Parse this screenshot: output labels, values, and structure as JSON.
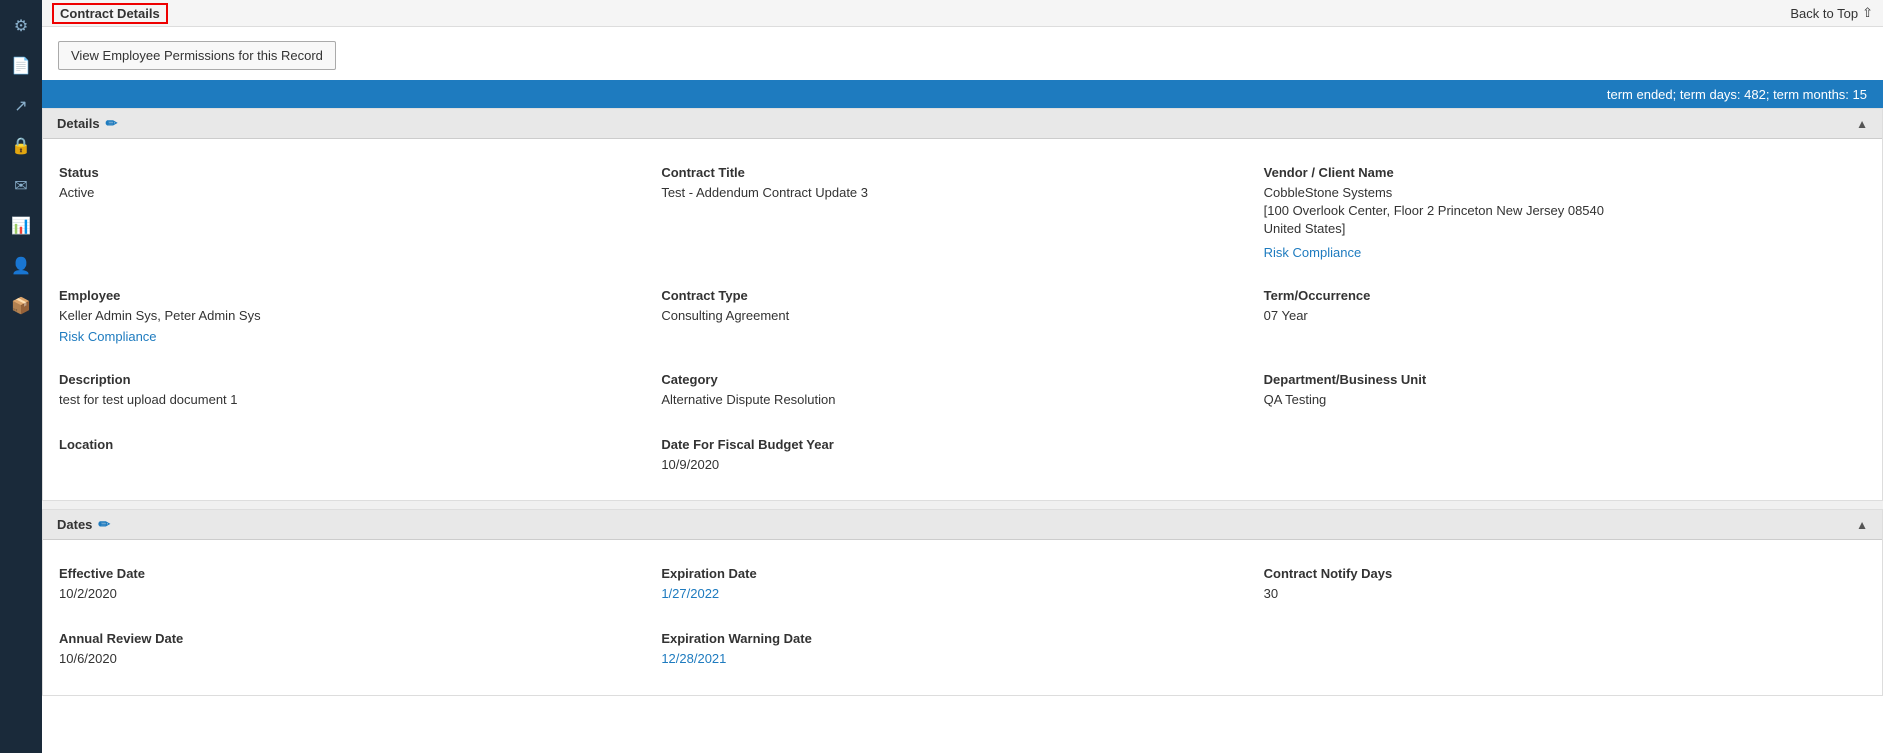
{
  "topbar": {
    "title": "Contract Details",
    "back_to_top": "Back to Top"
  },
  "permissions_button": "View Employee Permissions for this Record",
  "banner": {
    "text": "term ended; term days: 482; term months: 15"
  },
  "details_section": {
    "header": "Details",
    "collapse_icon": "▲",
    "fields": [
      {
        "row": 1,
        "col1_label": "Status",
        "col1_value": "Active",
        "col1_link": null,
        "col2_label": "Contract Title",
        "col2_value": "Test - Addendum Contract Update 3",
        "col2_link": null,
        "col3_label": "Vendor / Client Name",
        "col3_value": "CobbleStone Systems\n[100 Overlook Center, Floor 2 Princeton New Jersey 08540\nUnited States]",
        "col3_link": "Risk Compliance"
      },
      {
        "row": 2,
        "col1_label": "Employee",
        "col1_value": "Keller Admin Sys, Peter Admin Sys",
        "col1_link": "Risk Compliance",
        "col2_label": "Contract Type",
        "col2_value": "Consulting Agreement",
        "col2_link": null,
        "col3_label": "Term/Occurrence",
        "col3_value": "07 Year",
        "col3_link": null
      },
      {
        "row": 3,
        "col1_label": "Description",
        "col1_value": "test for test upload document 1",
        "col1_link": null,
        "col2_label": "Category",
        "col2_value": "Alternative Dispute Resolution",
        "col2_link": null,
        "col3_label": "Department/Business Unit",
        "col3_value": "QA Testing",
        "col3_link": null
      },
      {
        "row": 4,
        "col1_label": "Location",
        "col1_value": "",
        "col1_link": null,
        "col2_label": "Date For Fiscal Budget Year",
        "col2_value": "10/9/2020",
        "col2_link": null,
        "col3_label": "",
        "col3_value": "",
        "col3_link": null
      }
    ]
  },
  "dates_section": {
    "header": "Dates",
    "collapse_icon": "▲",
    "fields": [
      {
        "row": 1,
        "col1_label": "Effective Date",
        "col1_value": "10/2/2020",
        "col1_link": null,
        "col2_label": "Expiration Date",
        "col2_value": "1/27/2022",
        "col2_link": "1/27/2022",
        "col2_value_plain": "",
        "col3_label": "Contract Notify Days",
        "col3_value": "30",
        "col3_link": null
      },
      {
        "row": 2,
        "col1_label": "Annual Review Date",
        "col1_value": "10/6/2020",
        "col1_link": null,
        "col2_label": "Expiration Warning Date",
        "col2_value": "12/28/2021",
        "col2_link": "12/28/2021",
        "col3_label": "",
        "col3_value": "",
        "col3_link": null
      }
    ]
  },
  "sidebar": {
    "icons": [
      {
        "name": "gear-icon",
        "symbol": "⚙"
      },
      {
        "name": "document-icon",
        "symbol": "📄"
      },
      {
        "name": "share-icon",
        "symbol": "↗"
      },
      {
        "name": "lock-icon",
        "symbol": "🔒"
      },
      {
        "name": "mail-icon",
        "symbol": "✉"
      },
      {
        "name": "chart-icon",
        "symbol": "📊"
      },
      {
        "name": "user-icon",
        "symbol": "👤"
      },
      {
        "name": "box-icon",
        "symbol": "📦"
      }
    ]
  },
  "colors": {
    "accent_blue": "#1e7bbf",
    "banner_blue": "#1e7bbf",
    "border_red": "#cc0000",
    "sidebar_bg": "#1a2a3a"
  }
}
